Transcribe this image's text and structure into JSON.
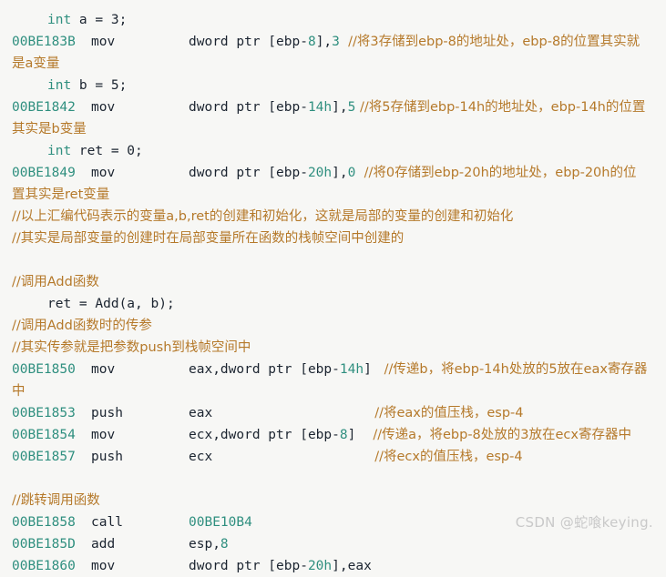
{
  "editor": {
    "background_color": "#f7f7f5",
    "colors": {
      "keyword": "#2f8f7f",
      "address": "#2f8f7f",
      "number": "#2f8f7f",
      "plain": "#1b2430",
      "comment": "#b5792a",
      "watermark": "#c9c9c9"
    }
  },
  "watermark": {
    "text": "CSDN @蛇喰keying."
  },
  "lines": {
    "l1_src_kw": "int",
    "l1_src_rest": " a = 3;",
    "l2_addr": "00BE183B",
    "l2_mnem": "mov",
    "l2_op_a": "dword ptr [ebp-",
    "l2_op_num": "8",
    "l2_op_b": "],",
    "l2_op_num2": "3",
    "l2_cmt": "//将3存储到ebp-8的地址处，ebp-8的位置其实就",
    "l3_cmt_wrap": "是a变量",
    "l4_src_kw": "int",
    "l4_src_rest": " b = 5;",
    "l5_addr": "00BE1842",
    "l5_mnem": "mov",
    "l5_op_a": "dword ptr [ebp-",
    "l5_op_num": "14h",
    "l5_op_b": "],",
    "l5_op_num2": "5",
    "l5_cmt": "//将5存储到ebp-14h的地址处，ebp-14h的位置",
    "l6_cmt_wrap": "其实是b变量",
    "l7_src_kw": "int",
    "l7_src_rest": " ret = 0;",
    "l8_addr": "00BE1849",
    "l8_mnem": "mov",
    "l8_op_a": "dword ptr [ebp-",
    "l8_op_num": "20h",
    "l8_op_b": "],",
    "l8_op_num2": "0",
    "l8_cmt": "//将0存储到ebp-20h的地址处，ebp-20h的位",
    "l9_cmt_wrap": "置其实是ret变量",
    "l10_cmt": "//以上汇编代码表示的变量a,b,ret的创建和初始化，这就是局部的变量的创建和初始化",
    "l11_cmt": "//其实是局部变量的创建时在局部变量所在函数的栈帧空间中创建的",
    "l13_cmt": "//调用Add函数",
    "l14_src": "ret = Add(a, b);",
    "l15_cmt": "//调用Add函数时的传参",
    "l16_cmt": "//其实传参就是把参数push到栈帧空间中",
    "l17_addr": "00BE1850",
    "l17_mnem": "mov",
    "l17_op_a": "eax,dword ptr [ebp-",
    "l17_op_num": "14h",
    "l17_op_b": "]",
    "l17_cmt": "//传递b，将ebp-14h处放的5放在eax寄存器",
    "l18_cmt_wrap": "中",
    "l19_addr": "00BE1853",
    "l19_mnem": "push",
    "l19_op": "eax",
    "l19_cmt": "//将eax的值压栈，esp-4",
    "l20_addr": "00BE1854",
    "l20_mnem": "mov",
    "l20_op_a": "ecx,dword ptr [ebp-",
    "l20_op_num": "8",
    "l20_op_b": "]",
    "l20_cmt": "//传递a，将ebp-8处放的3放在ecx寄存器中",
    "l21_addr": "00BE1857",
    "l21_mnem": "push",
    "l21_op": "ecx",
    "l21_cmt": "//将ecx的值压栈，esp-4",
    "l23_cmt": "//跳转调用函数",
    "l24_addr": "00BE1858",
    "l24_mnem": "call",
    "l24_op": "00BE10B4",
    "l25_addr": "00BE185D",
    "l25_mnem": "add",
    "l25_op_a": "esp,",
    "l25_op_num": "8",
    "l26_addr": "00BE1860",
    "l26_mnem": "mov",
    "l26_op_a": "dword ptr [ebp-",
    "l26_op_num": "20h",
    "l26_op_b": "],eax"
  }
}
